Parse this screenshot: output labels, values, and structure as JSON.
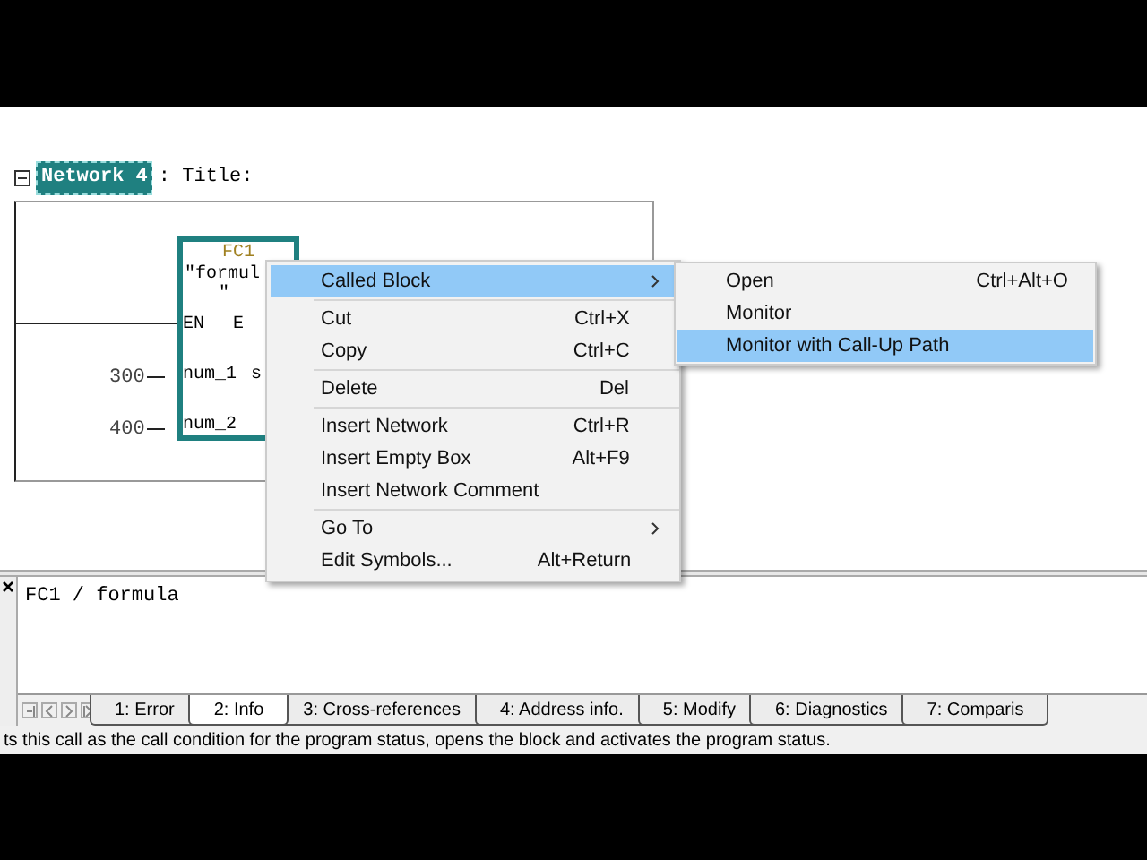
{
  "network": {
    "label": "Network 4",
    "title": ": Title:",
    "expanded": true
  },
  "block": {
    "name": "FC1",
    "symbol": "\"formul",
    "symbol_end": "\"",
    "en": "EN",
    "eno": "E",
    "inputs": [
      {
        "value": "300",
        "pin": "num_1",
        "output": "s"
      },
      {
        "value": "400",
        "pin": "num_2"
      }
    ]
  },
  "context_menu": {
    "groups": [
      [
        {
          "label": "Called Block",
          "submenu": true,
          "selected": true
        }
      ],
      [
        {
          "label": "Cut",
          "shortcut": "Ctrl+X",
          "submenu": false,
          "selected": false
        },
        {
          "label": "Copy",
          "shortcut": "Ctrl+C",
          "submenu": false,
          "selected": false
        }
      ],
      [
        {
          "label": "Delete",
          "shortcut": "Del",
          "submenu": false,
          "selected": false
        }
      ],
      [
        {
          "label": "Insert Network",
          "shortcut": "Ctrl+R",
          "submenu": false,
          "selected": false
        },
        {
          "label": "Insert Empty Box",
          "shortcut": "Alt+F9",
          "submenu": false,
          "selected": false
        },
        {
          "label": "Insert Network Comment",
          "submenu": false,
          "selected": false
        }
      ],
      [
        {
          "label": "Go To",
          "submenu": true,
          "selected": false
        },
        {
          "label": "Edit Symbols...",
          "shortcut": "Alt+Return",
          "submenu": false,
          "selected": false
        }
      ]
    ]
  },
  "submenu": [
    {
      "label": "Open",
      "shortcut": "Ctrl+Alt+O",
      "selected": false
    },
    {
      "label": "Monitor",
      "selected": false
    },
    {
      "label": "Monitor with Call-Up Path",
      "selected": true
    }
  ],
  "info_panel": {
    "text": "FC1 / formula"
  },
  "tabs": [
    {
      "label": "1: Error",
      "selected": false
    },
    {
      "label": "2: Info",
      "selected": true
    },
    {
      "label": "3: Cross-references",
      "selected": false
    },
    {
      "label": "4: Address info.",
      "selected": false
    },
    {
      "label": "5: Modify",
      "selected": false
    },
    {
      "label": "6: Diagnostics",
      "selected": false
    },
    {
      "label": "7: Comparis",
      "selected": false
    }
  ],
  "status_bar": "ts this call as the call condition for the program status, opens the block and activates the program status."
}
